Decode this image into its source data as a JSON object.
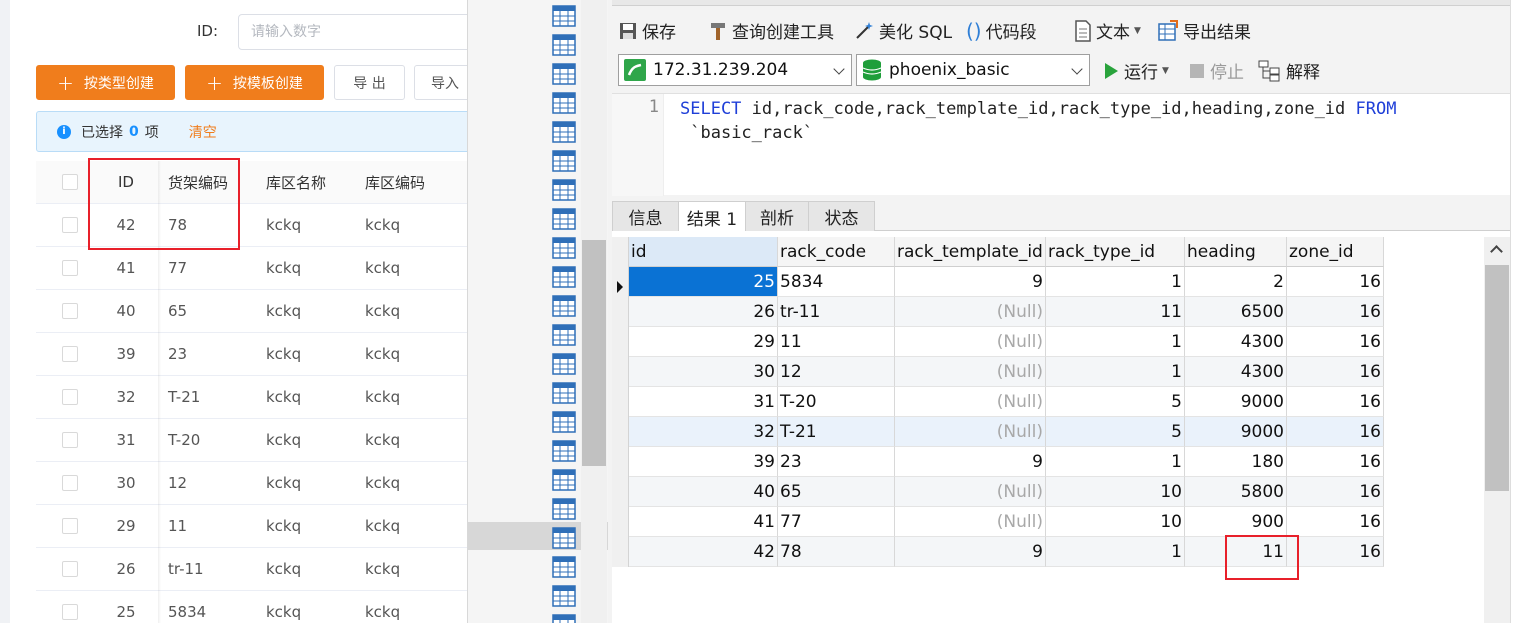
{
  "webapp": {
    "filter": {
      "id_label": "ID:",
      "id_placeholder": "请输入数字"
    },
    "buttons": {
      "create_by_type": "按类型创建",
      "create_by_template": "按模板创建",
      "export": "导 出",
      "import": "导入"
    },
    "alert": {
      "selected_prefix": "已选择",
      "selected_count": "0",
      "selected_suffix": "项",
      "clear": "清空"
    },
    "table": {
      "headers": {
        "id": "ID",
        "rack_code": "货架编码",
        "zone_name": "库区名称",
        "zone_code": "库区编码"
      },
      "rows": [
        {
          "id": "42",
          "rack_code": "78",
          "zone_name": "kckq",
          "zone_code": "kckq"
        },
        {
          "id": "41",
          "rack_code": "77",
          "zone_name": "kckq",
          "zone_code": "kckq"
        },
        {
          "id": "40",
          "rack_code": "65",
          "zone_name": "kckq",
          "zone_code": "kckq"
        },
        {
          "id": "39",
          "rack_code": "23",
          "zone_name": "kckq",
          "zone_code": "kckq"
        },
        {
          "id": "32",
          "rack_code": "T-21",
          "zone_name": "kckq",
          "zone_code": "kckq"
        },
        {
          "id": "31",
          "rack_code": "T-20",
          "zone_name": "kckq",
          "zone_code": "kckq"
        },
        {
          "id": "30",
          "rack_code": "12",
          "zone_name": "kckq",
          "zone_code": "kckq"
        },
        {
          "id": "29",
          "rack_code": "11",
          "zone_name": "kckq",
          "zone_code": "kckq"
        },
        {
          "id": "26",
          "rack_code": "tr-11",
          "zone_name": "kckq",
          "zone_code": "kckq"
        },
        {
          "id": "25",
          "rack_code": "5834",
          "zone_name": "kckq",
          "zone_code": "kckq"
        }
      ]
    }
  },
  "navicat": {
    "toolbar": {
      "save": "保存",
      "query_builder": "查询创建工具",
      "beautify_sql": "美化 SQL",
      "code_snippet": "代码段",
      "text": "文本",
      "export_results": "导出结果",
      "run": "运行",
      "stop": "停止",
      "explain": "解释"
    },
    "connection": "172.31.239.204",
    "database": "phoenix_basic",
    "editor": {
      "line_number": "1",
      "kw_select": "SELECT",
      "columns": " id,rack_code,rack_template_id,rack_type_id,heading,zone_id ",
      "kw_from": "FROM",
      "table": "`basic_rack`"
    },
    "result_tabs": [
      "信息",
      "结果 1",
      "剖析",
      "状态"
    ],
    "active_tab": "结果 1",
    "grid": {
      "headers": [
        "id",
        "rack_code",
        "rack_template_id",
        "rack_type_id",
        "heading",
        "zone_id"
      ],
      "null_text": "(Null)",
      "rows": [
        {
          "id": "25",
          "rack_code": "5834",
          "rack_template_id": "9",
          "rack_type_id": "1",
          "heading": "2",
          "zone_id": "16"
        },
        {
          "id": "26",
          "rack_code": "tr-11",
          "rack_template_id": "(Null)",
          "rack_type_id": "11",
          "heading": "6500",
          "zone_id": "16"
        },
        {
          "id": "29",
          "rack_code": "11",
          "rack_template_id": "(Null)",
          "rack_type_id": "1",
          "heading": "4300",
          "zone_id": "16"
        },
        {
          "id": "30",
          "rack_code": "12",
          "rack_template_id": "(Null)",
          "rack_type_id": "1",
          "heading": "4300",
          "zone_id": "16"
        },
        {
          "id": "31",
          "rack_code": "T-20",
          "rack_template_id": "(Null)",
          "rack_type_id": "5",
          "heading": "9000",
          "zone_id": "16"
        },
        {
          "id": "32",
          "rack_code": "T-21",
          "rack_template_id": "(Null)",
          "rack_type_id": "5",
          "heading": "9000",
          "zone_id": "16"
        },
        {
          "id": "39",
          "rack_code": "23",
          "rack_template_id": "9",
          "rack_type_id": "1",
          "heading": "180",
          "zone_id": "16"
        },
        {
          "id": "40",
          "rack_code": "65",
          "rack_template_id": "(Null)",
          "rack_type_id": "10",
          "heading": "5800",
          "zone_id": "16"
        },
        {
          "id": "41",
          "rack_code": "77",
          "rack_template_id": "(Null)",
          "rack_type_id": "10",
          "heading": "900",
          "zone_id": "16"
        },
        {
          "id": "42",
          "rack_code": "78",
          "rack_template_id": "9",
          "rack_type_id": "1",
          "heading": "11",
          "zone_id": "16"
        }
      ]
    }
  },
  "colors": {
    "accent_orange": "#f07d1c",
    "info_blue": "#1890ff",
    "sql_keyword": "#1f3fd8",
    "grid_selection": "#0a72d4",
    "annotation_red": "#e8202a",
    "null_gray": "#a8a8a8"
  }
}
